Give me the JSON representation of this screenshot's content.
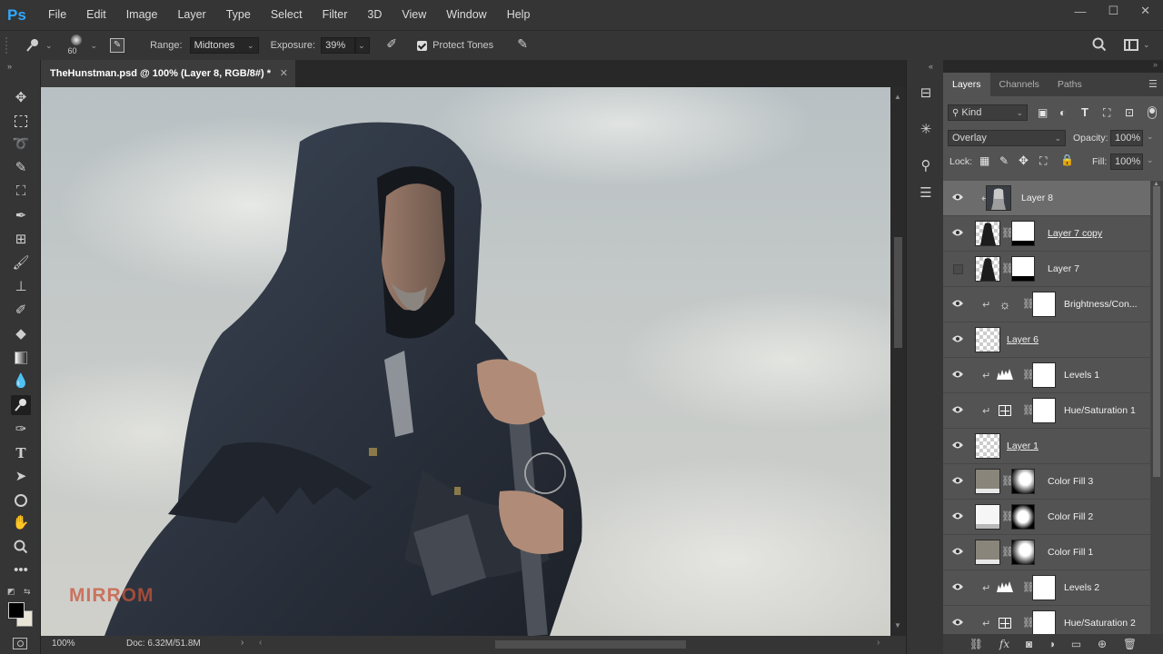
{
  "app": {
    "logo": "Ps"
  },
  "menu": [
    "File",
    "Edit",
    "Image",
    "Layer",
    "Type",
    "Select",
    "Filter",
    "3D",
    "View",
    "Window",
    "Help"
  ],
  "window_controls": {
    "minimize": "—",
    "maximize": "☐",
    "close": "✕"
  },
  "options": {
    "brush_size": "60",
    "range_label": "Range:",
    "range_value": "Midtones",
    "exposure_label": "Exposure:",
    "exposure_value": "39%",
    "protect_tones_label": "Protect Tones",
    "protect_tones_checked": true
  },
  "document": {
    "tab_title": "TheHunstman.psd @ 100% (Layer 8, RGB/8#) *",
    "watermark": "MIRROM",
    "zoom": "100%",
    "doc_size": "Doc: 6.32M/51.8M"
  },
  "panel": {
    "tabs": [
      "Layers",
      "Channels",
      "Paths"
    ],
    "active_tab": "Layers",
    "filter_kind": "Kind",
    "blend_mode": "Overlay",
    "opacity_label": "Opacity:",
    "opacity_value": "100%",
    "lock_label": "Lock:",
    "fill_label": "Fill:",
    "fill_value": "100%"
  },
  "layers": [
    {
      "name": "Layer 8",
      "visible": true,
      "selected": true,
      "clipped": true,
      "thumb": "person",
      "underlined": false
    },
    {
      "name": "Layer 7 copy",
      "visible": true,
      "selected": false,
      "clipped": false,
      "thumb": "figure-mask",
      "underlined": true
    },
    {
      "name": "Layer 7",
      "visible": false,
      "selected": false,
      "clipped": false,
      "thumb": "figure-mask",
      "underlined": false
    },
    {
      "name": "Brightness/Con...",
      "visible": true,
      "selected": false,
      "clipped": true,
      "thumb": "adj-brightness",
      "underlined": false
    },
    {
      "name": "Layer 6",
      "visible": true,
      "selected": false,
      "clipped": false,
      "thumb": "transparent",
      "underlined": true
    },
    {
      "name": "Levels 1",
      "visible": true,
      "selected": false,
      "clipped": true,
      "thumb": "adj-levels",
      "underlined": false
    },
    {
      "name": "Hue/Saturation 1",
      "visible": true,
      "selected": false,
      "clipped": true,
      "thumb": "adj-huesat",
      "underlined": false
    },
    {
      "name": "Layer 1",
      "visible": true,
      "selected": false,
      "clipped": false,
      "thumb": "transparent",
      "underlined": true
    },
    {
      "name": "Color Fill 3",
      "visible": true,
      "selected": false,
      "clipped": false,
      "thumb": "fill-gray",
      "underlined": false
    },
    {
      "name": "Color Fill 2",
      "visible": true,
      "selected": false,
      "clipped": false,
      "thumb": "fill-white",
      "underlined": false
    },
    {
      "name": "Color Fill 1",
      "visible": true,
      "selected": false,
      "clipped": false,
      "thumb": "fill-gray",
      "underlined": false
    },
    {
      "name": "Levels 2",
      "visible": true,
      "selected": false,
      "clipped": true,
      "thumb": "adj-levels",
      "underlined": false
    },
    {
      "name": "Hue/Saturation 2",
      "visible": true,
      "selected": false,
      "clipped": true,
      "thumb": "adj-huesat",
      "underlined": false
    }
  ],
  "colors": {
    "accent": "#30a8ff",
    "watermark": "#c8553a"
  }
}
